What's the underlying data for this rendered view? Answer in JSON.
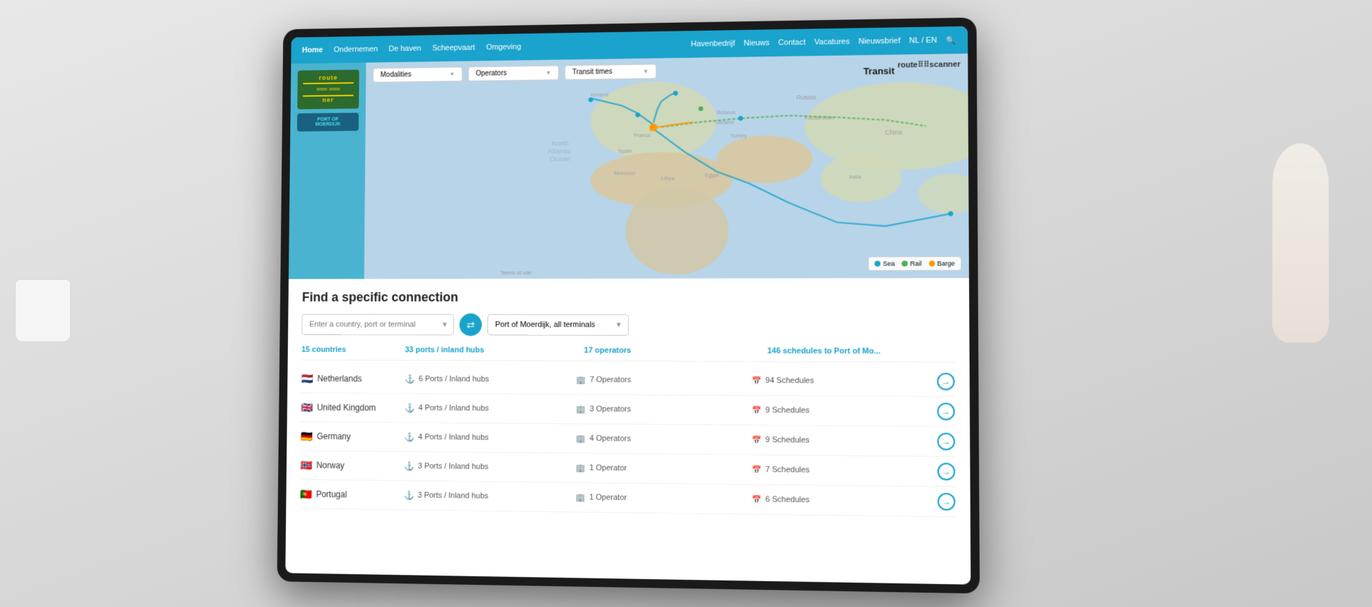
{
  "desk": {
    "background": "#d0d0d0"
  },
  "nav": {
    "left_items": [
      "Home",
      "Ondernemen",
      "De haven",
      "Scheepvaart",
      "Omgeving"
    ],
    "right_items": [
      "Havenbedrijf",
      "Nieuws",
      "Contact",
      "Vacatures",
      "Nieuwsbrief",
      "NL / EN"
    ],
    "active": "Home"
  },
  "map": {
    "transit_label": "Transit",
    "routescanner_label": "route⠿⠿scanner",
    "modalities_placeholder": "Modalities",
    "operators_placeholder": "Operators",
    "transit_times_placeholder": "Transit times",
    "legend": {
      "sea_label": "Sea",
      "rail_label": "Rail",
      "barge_label": "Barge",
      "sea_color": "#1aa3cc",
      "rail_color": "#4caf50",
      "barge_color": "#ff9800"
    }
  },
  "logos": {
    "routescanner_line1": "route",
    "routescanner_line2": "scan",
    "routescanner_line3": "ner",
    "port_line1": "PORT OF",
    "port_line2": "MOERDIJK"
  },
  "connection": {
    "title": "Find a specific connection",
    "search_placeholder": "Enter a country, port or terminal",
    "destination": "Port of Moerdijk, all terminals",
    "stats": {
      "countries": "15 countries",
      "ports": "33 ports / inland hubs",
      "operators": "17 operators",
      "schedules": "146 schedules to Port of Mo..."
    },
    "countries": [
      {
        "flag": "🇳🇱",
        "name": "Netherlands",
        "ports": "6 Ports / Inland hubs",
        "operators": "7 Operators",
        "schedules": "94 Schedules"
      },
      {
        "flag": "🇬🇧",
        "name": "United Kingdom",
        "ports": "4 Ports / Inland hubs",
        "operators": "3 Operators",
        "schedules": "9 Schedules"
      },
      {
        "flag": "🇩🇪",
        "name": "Germany",
        "ports": "4 Ports / Inland hubs",
        "operators": "4 Operators",
        "schedules": "9 Schedules"
      },
      {
        "flag": "🇳🇴",
        "name": "Norway",
        "ports": "3 Ports / Inland hubs",
        "operators": "1 Operator",
        "schedules": "7 Schedules"
      },
      {
        "flag": "🇵🇹",
        "name": "Portugal",
        "ports": "3 Ports / Inland hubs",
        "operators": "1 Operator",
        "schedules": "6 Schedules"
      }
    ]
  }
}
